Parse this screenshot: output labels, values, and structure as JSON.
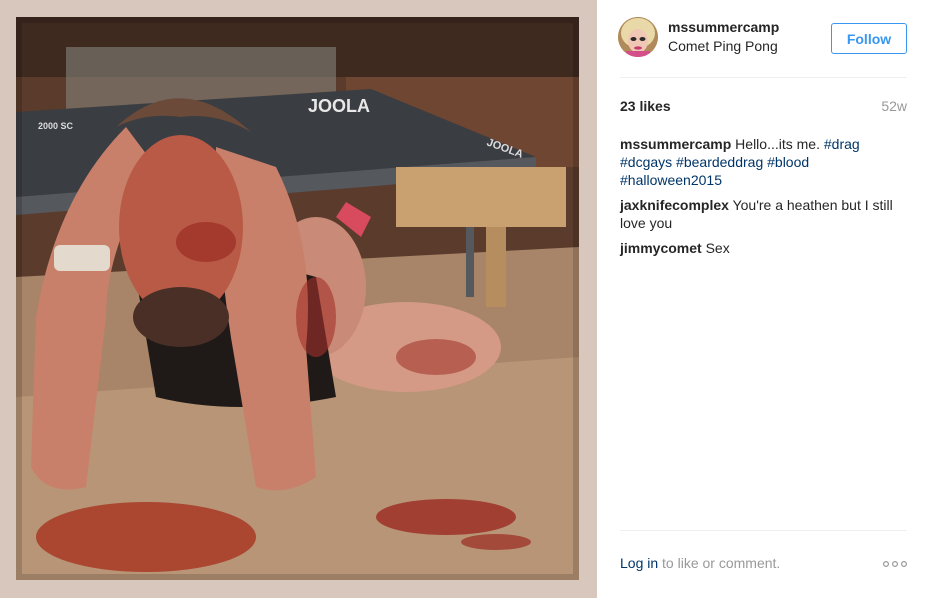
{
  "post": {
    "username": "mssummercamp",
    "location": "Comet Ping Pong",
    "follow_label": "Follow",
    "likes": "23 likes",
    "age": "52w",
    "caption": {
      "author": "mssummercamp",
      "text": "Hello...its me.",
      "hashtags": [
        "#drag",
        "#dcgays",
        "#beardeddrag",
        "#blood",
        "#halloween2015"
      ]
    },
    "comments": [
      {
        "author": "jaxknifecomplex",
        "text": "You're a heathen but I still love you"
      },
      {
        "author": "jimmycomet",
        "text": "Sex"
      }
    ],
    "login_link": "Log in",
    "login_suffix": "to like or comment.",
    "photo": {
      "table_brand": "JOOLA",
      "table_brand_side": "JOOLA",
      "table_model": "2000 SC"
    }
  },
  "colors": {
    "link_blue": "#3897f0",
    "hashtag_navy": "#003569",
    "muted_gray": "#999999"
  }
}
